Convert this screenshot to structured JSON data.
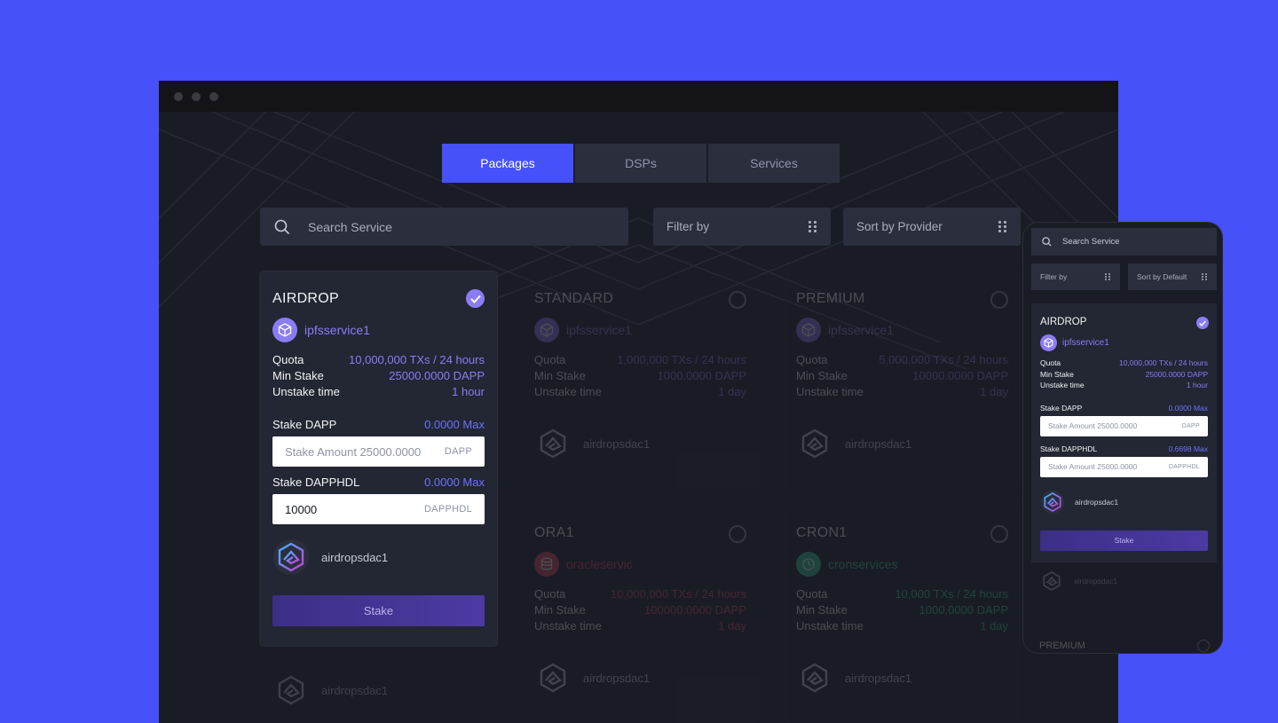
{
  "tabs": [
    {
      "label": "Packages",
      "active": true
    },
    {
      "label": "DSPs",
      "active": false
    },
    {
      "label": "Services",
      "active": false
    }
  ],
  "search": {
    "placeholder": "Search Service"
  },
  "filter": {
    "label": "Filter by"
  },
  "sort": {
    "label": "Sort by Provider"
  },
  "cards": [
    {
      "title": "AIRDROP",
      "selected": true,
      "service": "ipfsservice1",
      "quota_label": "Quota",
      "quota": "10,000,000 TXs / 24 hours",
      "minstake_label": "Min Stake",
      "minstake": "25000.0000 DAPP",
      "unstake_label": "Unstake time",
      "unstake": "1 hour",
      "stake1_label": "Stake DAPP",
      "stake1_max": "0.0000 Max",
      "stake1_placeholder": "Stake Amount 25000.0000",
      "stake1_unit": "DAPP",
      "stake2_label": "Stake DAPPHDL",
      "stake2_max": "0.0000 Max",
      "stake2_value": "10000",
      "stake2_unit": "DAPPHDL",
      "provider": "airdropsdac1",
      "button": "Stake"
    },
    {
      "title": "STANDARD",
      "selected": false,
      "service": "ipfsservice1",
      "quota_label": "Quota",
      "quota": "1,000,000 TXs / 24 hours",
      "minstake_label": "Min Stake",
      "minstake": "1000.0000 DAPP",
      "unstake_label": "Unstake time",
      "unstake": "1 day",
      "provider": "airdropsdac1"
    },
    {
      "title": "PREMIUM",
      "selected": false,
      "service": "ipfsservice1",
      "quota_label": "Quota",
      "quota": "5,000,000 TXs / 24 hours",
      "minstake_label": "Min Stake",
      "minstake": "10000.0000 DAPP",
      "unstake_label": "Unstake time",
      "unstake": "1 day",
      "provider": "airdropsdac1"
    },
    {
      "title": "ORA1",
      "selected": false,
      "service": "oracleservic",
      "quota_label": "Quota",
      "quota": "10,000,000 TXs / 24 hours",
      "minstake_label": "Min Stake",
      "minstake": "100000.0000 DAPP",
      "unstake_label": "Unstake time",
      "unstake": "1 day",
      "provider": "airdropsdac1"
    },
    {
      "title": "CRON1",
      "selected": false,
      "service": "cronservices",
      "quota_label": "Quota",
      "quota": "10,000 TXs / 24 hours",
      "minstake_label": "Min Stake",
      "minstake": "1000.0000 DAPP",
      "unstake_label": "Unstake time",
      "unstake": "1 day",
      "provider": "airdropsdac1"
    }
  ],
  "bottom_providers": [
    "airdropsdac1",
    "airdropsdac1",
    "airdropsdac1"
  ],
  "mobile": {
    "search": "Search Service",
    "filter": "Filter by",
    "sort": "Sort by Default",
    "card": {
      "title": "AIRDROP",
      "service": "ipfsservice1",
      "quota_label": "Quota",
      "quota": "10,000,000 TXs / 24 hours",
      "minstake_label": "Min Stake",
      "minstake": "25000.0000 DAPP",
      "unstake_label": "Unstake time",
      "unstake": "1 hour",
      "stake1_label": "Stake DAPP",
      "stake1_max": "0.0000 Max",
      "stake1_placeholder": "Stake Amount 25000.0000",
      "stake1_unit": "DAPP",
      "stake2_label": "Stake DAPPHDL",
      "stake2_max": "0.6698 Max",
      "stake2_placeholder": "Stake Amount 25000.0000",
      "stake2_unit": "DAPPHDL",
      "provider": "airdropsdac1",
      "button": "Stake"
    },
    "next_provider": "airdropsdac1",
    "next_title": "PREMIUM"
  },
  "colors": {
    "background": "#4651f9",
    "accent": "#8b7cf6",
    "link": "#6c72ff"
  }
}
